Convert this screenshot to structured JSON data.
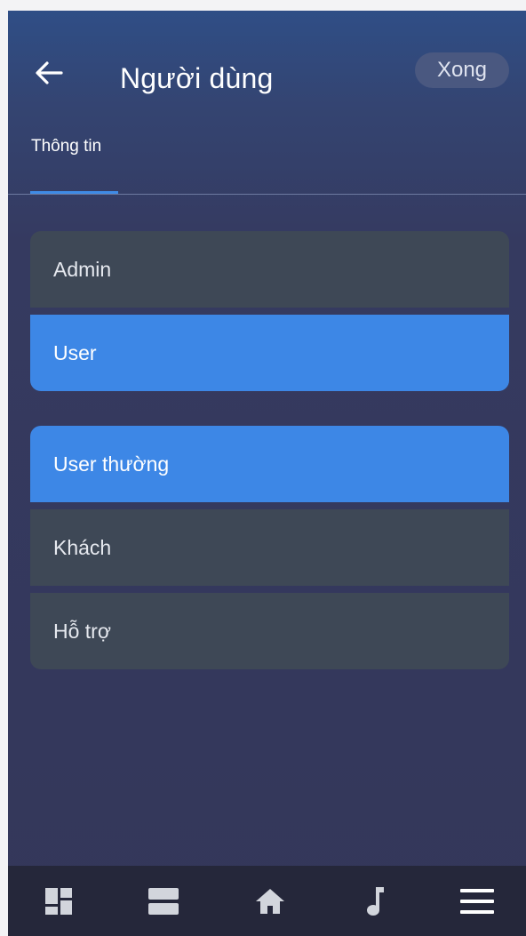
{
  "header": {
    "title": "Người dùng",
    "done_label": "Xong"
  },
  "tabs": [
    {
      "label": "Thông tin",
      "active": true
    }
  ],
  "groups": [
    {
      "items": [
        {
          "label": "Admin",
          "selected": false
        },
        {
          "label": "User",
          "selected": true
        }
      ]
    },
    {
      "items": [
        {
          "label": "User thường",
          "selected": true
        },
        {
          "label": "Khách",
          "selected": false
        },
        {
          "label": "Hỗ trợ",
          "selected": false
        }
      ]
    }
  ],
  "bottom_nav": {
    "items": [
      {
        "icon": "dashboard-icon"
      },
      {
        "icon": "rows-icon"
      },
      {
        "icon": "home-icon"
      },
      {
        "icon": "music-note-icon"
      },
      {
        "icon": "menu-icon"
      }
    ]
  },
  "colors": {
    "accent": "#3d87e6",
    "row_background": "#3e4856",
    "nav_background": "#25273a"
  }
}
